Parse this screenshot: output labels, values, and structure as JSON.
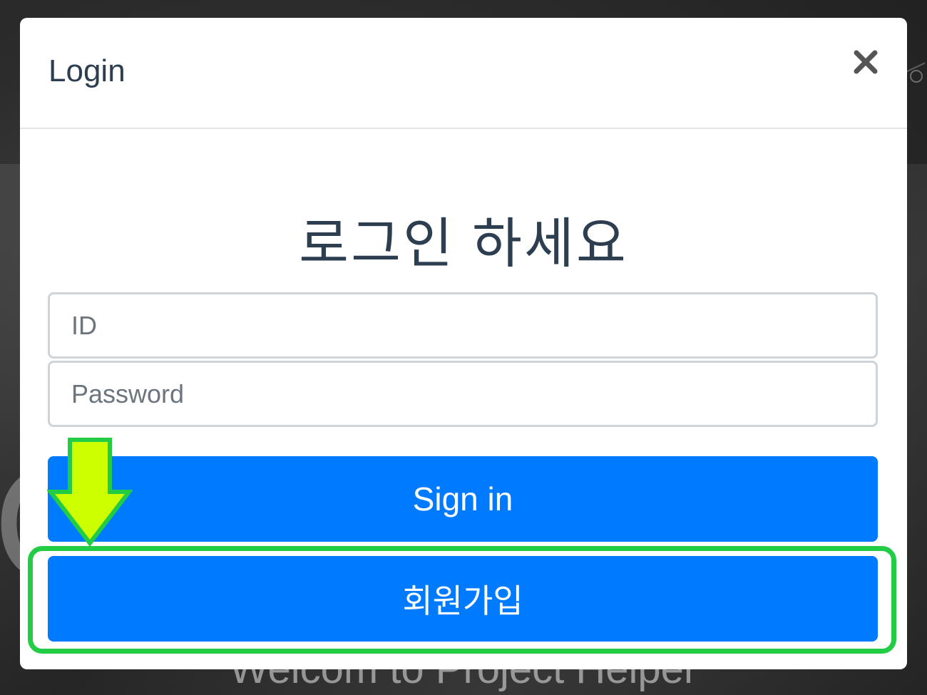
{
  "background": {
    "welcome_text": "Welcom to Project Helper",
    "big_letter": "C"
  },
  "modal": {
    "title": "Login",
    "close_symbol": "×",
    "heading": "로그인 하세요",
    "id_field": {
      "placeholder": "ID",
      "value": ""
    },
    "password_field": {
      "placeholder": "Password",
      "value": ""
    },
    "signin_label": "Sign in",
    "register_label": "회원가입"
  },
  "annotation": {
    "arrow_icon": "down-arrow-icon",
    "arrow_color": "#ccff00",
    "highlight_color": "#22cc44"
  },
  "colors": {
    "primary": "#007bff",
    "text_dark": "#2c3e50",
    "input_border": "#ced4da"
  }
}
